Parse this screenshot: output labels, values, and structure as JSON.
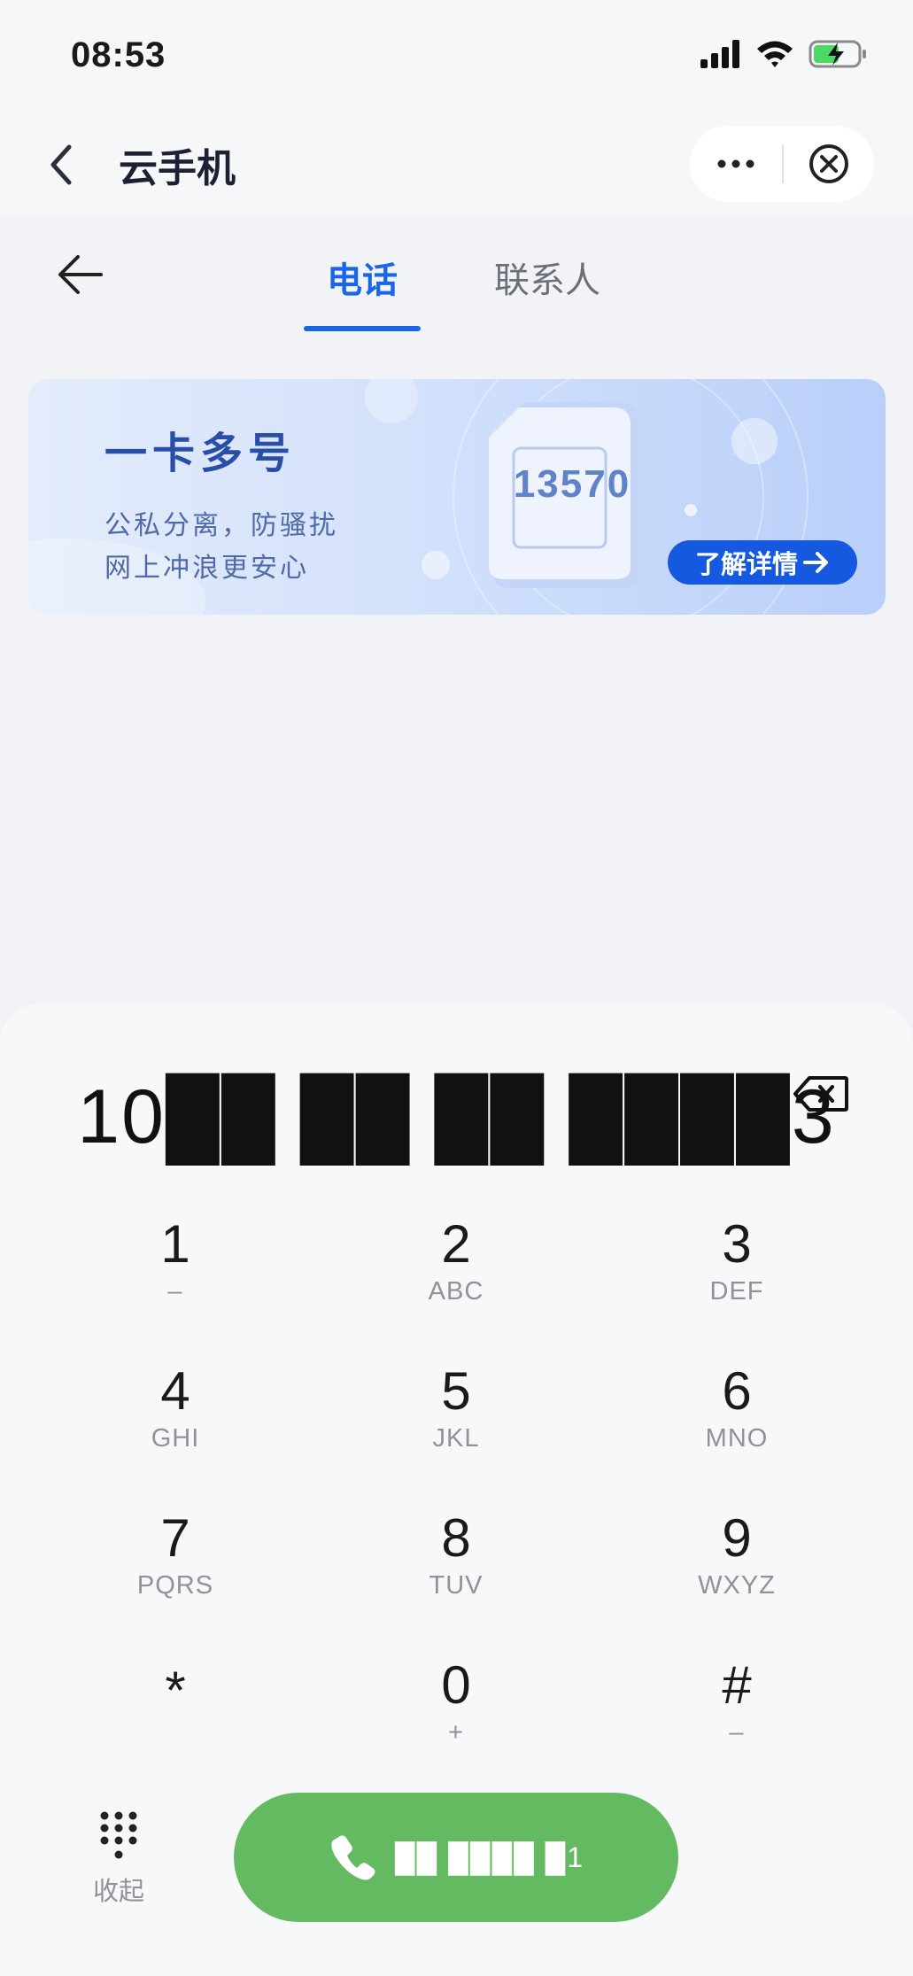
{
  "status_bar": {
    "time": "08:53"
  },
  "mini_program": {
    "title": "云手机"
  },
  "tabs": [
    {
      "label": "电话",
      "active": true
    },
    {
      "label": "联系人",
      "active": false
    }
  ],
  "banner": {
    "title": "一卡多号",
    "line1": "公私分离，防骚扰",
    "line2": "网上冲浪更安心",
    "button_label": "了解详情",
    "card_digits": "13570"
  },
  "dialer": {
    "number": "10██ ██ ██ ████3",
    "keys": [
      {
        "digit": "1",
        "letters": "–"
      },
      {
        "digit": "2",
        "letters": "ABC"
      },
      {
        "digit": "3",
        "letters": "DEF"
      },
      {
        "digit": "4",
        "letters": "GHI"
      },
      {
        "digit": "5",
        "letters": "JKL"
      },
      {
        "digit": "6",
        "letters": "MNO"
      },
      {
        "digit": "7",
        "letters": "PQRS"
      },
      {
        "digit": "8",
        "letters": "TUV"
      },
      {
        "digit": "9",
        "letters": "WXYZ"
      },
      {
        "digit": "*",
        "letters": ""
      },
      {
        "digit": "0",
        "letters": "+"
      },
      {
        "digit": "#",
        "letters": "–"
      }
    ],
    "collapse_label": "收起",
    "call_label": "██ ████ █1"
  },
  "colors": {
    "accent": "#1b66e8",
    "call": "#63ba60",
    "banner_button": "#1559e0"
  }
}
